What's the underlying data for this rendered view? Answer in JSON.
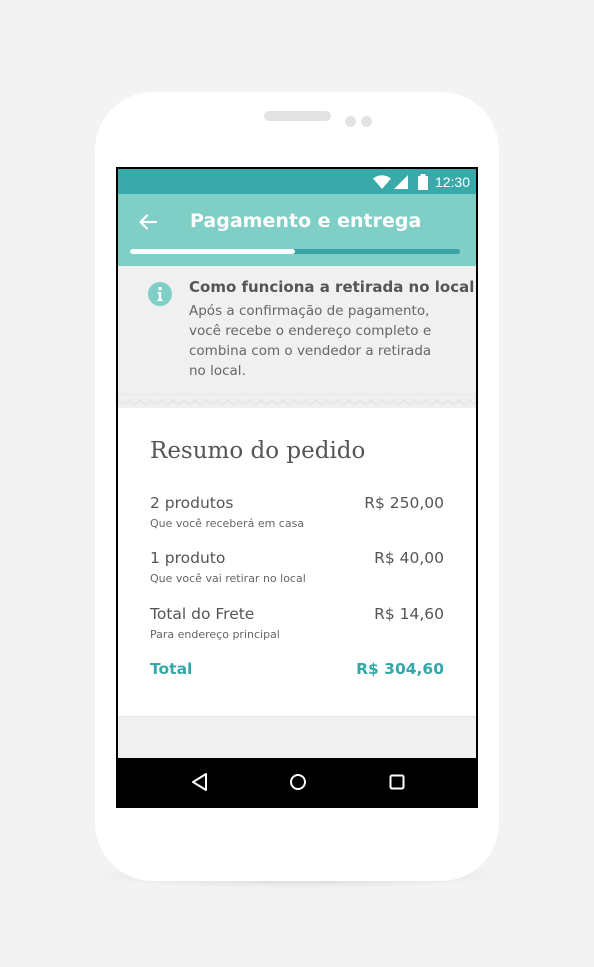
{
  "status_bar": {
    "time": "12:30",
    "icons": [
      "wifi-icon",
      "cell-signal-icon",
      "battery-icon"
    ]
  },
  "app_bar": {
    "title": "Pagamento e entrega",
    "back_icon": "arrow-left-icon",
    "progress": 0.5
  },
  "info_notice": {
    "icon": "info-icon",
    "title": "Como funciona a retirada no local",
    "body_lines": [
      "Após a confirmação de pagamento,",
      "você recebe o endereço completo e",
      "combina com o vendedor a retirada",
      "no local."
    ]
  },
  "summary": {
    "title": "Resumo do pedido",
    "rows": [
      {
        "label": "2 produtos",
        "sub": "Que você receberá em casa",
        "value": "R$ 250,00"
      },
      {
        "label": "1 produto",
        "sub": "Que você vai retirar no local",
        "value": "R$ 40,00"
      },
      {
        "label": "Total do Frete",
        "sub": "Para endereço principal",
        "value": "R$ 14,60"
      }
    ],
    "total": {
      "label": "Total",
      "value": "R$ 304,60"
    }
  },
  "nav_bar": {
    "icons": [
      "back-triangle-icon",
      "home-circle-icon",
      "recents-square-icon"
    ]
  },
  "colors": {
    "status_bar": "#39a9a9",
    "app_bar": "#7fcfc7",
    "accent": "#34a8a9",
    "background": "#f0f0f0"
  }
}
